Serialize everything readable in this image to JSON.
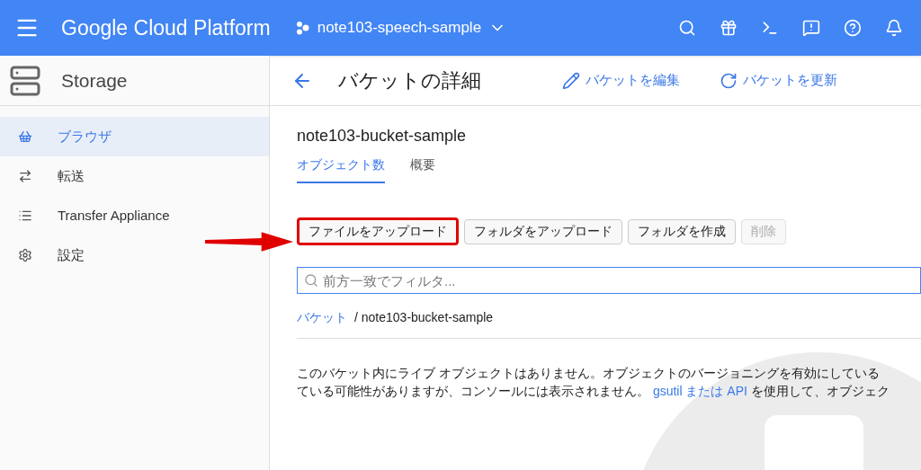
{
  "header": {
    "title": "Google Cloud Platform",
    "project": "note103-speech-sample"
  },
  "sidebar": {
    "title": "Storage",
    "items": [
      {
        "label": "ブラウザ",
        "selected": true
      },
      {
        "label": "転送",
        "selected": false
      },
      {
        "label": "Transfer Appliance",
        "selected": false
      },
      {
        "label": "設定",
        "selected": false
      }
    ]
  },
  "page": {
    "title": "バケットの詳細",
    "actions": [
      {
        "label": "バケットを編集"
      },
      {
        "label": "バケットを更新"
      }
    ]
  },
  "bucket_name": "note103-bucket-sample",
  "tabs": [
    {
      "label": "オブジェクト数",
      "selected": true
    },
    {
      "label": "概要",
      "selected": false
    }
  ],
  "buttons": [
    {
      "label": "ファイルをアップロード",
      "highlighted": true,
      "disabled": false
    },
    {
      "label": "フォルダをアップロード",
      "highlighted": false,
      "disabled": false
    },
    {
      "label": "フォルダを作成",
      "highlighted": false,
      "disabled": false
    },
    {
      "label": "削除",
      "highlighted": false,
      "disabled": true
    }
  ],
  "filter": {
    "placeholder": "前方一致でフィルタ..."
  },
  "breadcrumb": {
    "link": "バケット",
    "current": "/ note103-bucket-sample"
  },
  "message": {
    "line1": "このバケット内にライブ オブジェクトはありません。オブジェクトのバージョニングを有効にしている",
    "line2": "ている可能性がありますが、コンソールには表示されません。",
    "link": "gsutil または API",
    "after": "を使用して、オブジェク"
  }
}
